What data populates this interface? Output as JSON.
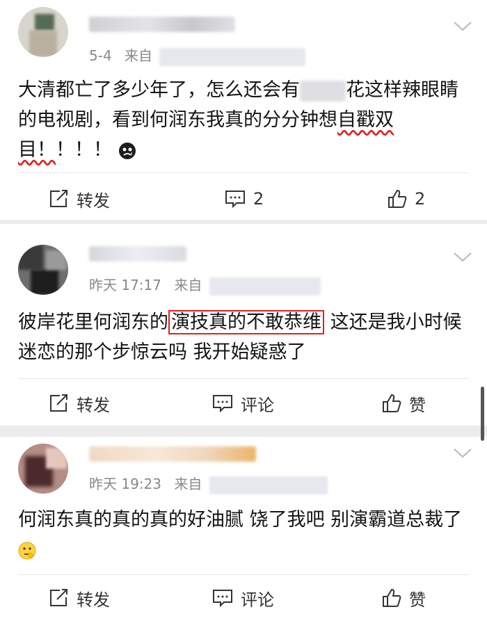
{
  "comments": [
    {
      "date": "5-4",
      "source_prefix": "来自",
      "text_part1": "大清都亡了多少年了，怎么还会有",
      "text_part2": "花这样辣眼睛的电视剧，看到何润东我真的分分钟想",
      "text_underline": "自戳双目！",
      "text_part3": "！！！",
      "actions": {
        "repost": "转发",
        "comment": "2",
        "like": "2"
      }
    },
    {
      "date": "昨天 17:17",
      "source_prefix": "来自",
      "text_part1": "彼岸花里何润东的",
      "text_boxed": "演技真的不敢恭维",
      "text_part2": " 这还是我小时候迷恋的那个步惊云吗 我开始疑惑了",
      "actions": {
        "repost": "转发",
        "comment": "评论",
        "like": "赞"
      }
    },
    {
      "date": "昨天 19:23",
      "source_prefix": "来自",
      "text_part1": "何润东真的真的真的好油腻 饶了我吧 别演霸道总裁了",
      "actions": {
        "repost": "转发",
        "comment": "评论",
        "like": "赞"
      }
    }
  ],
  "icons": {
    "repost": "share-square-icon",
    "comment": "comment-bubble-icon",
    "like": "thumbs-up-icon",
    "expand": "chevron-down-icon"
  },
  "colors": {
    "highlight_red": "#e02020",
    "meta_gray": "#888888"
  }
}
